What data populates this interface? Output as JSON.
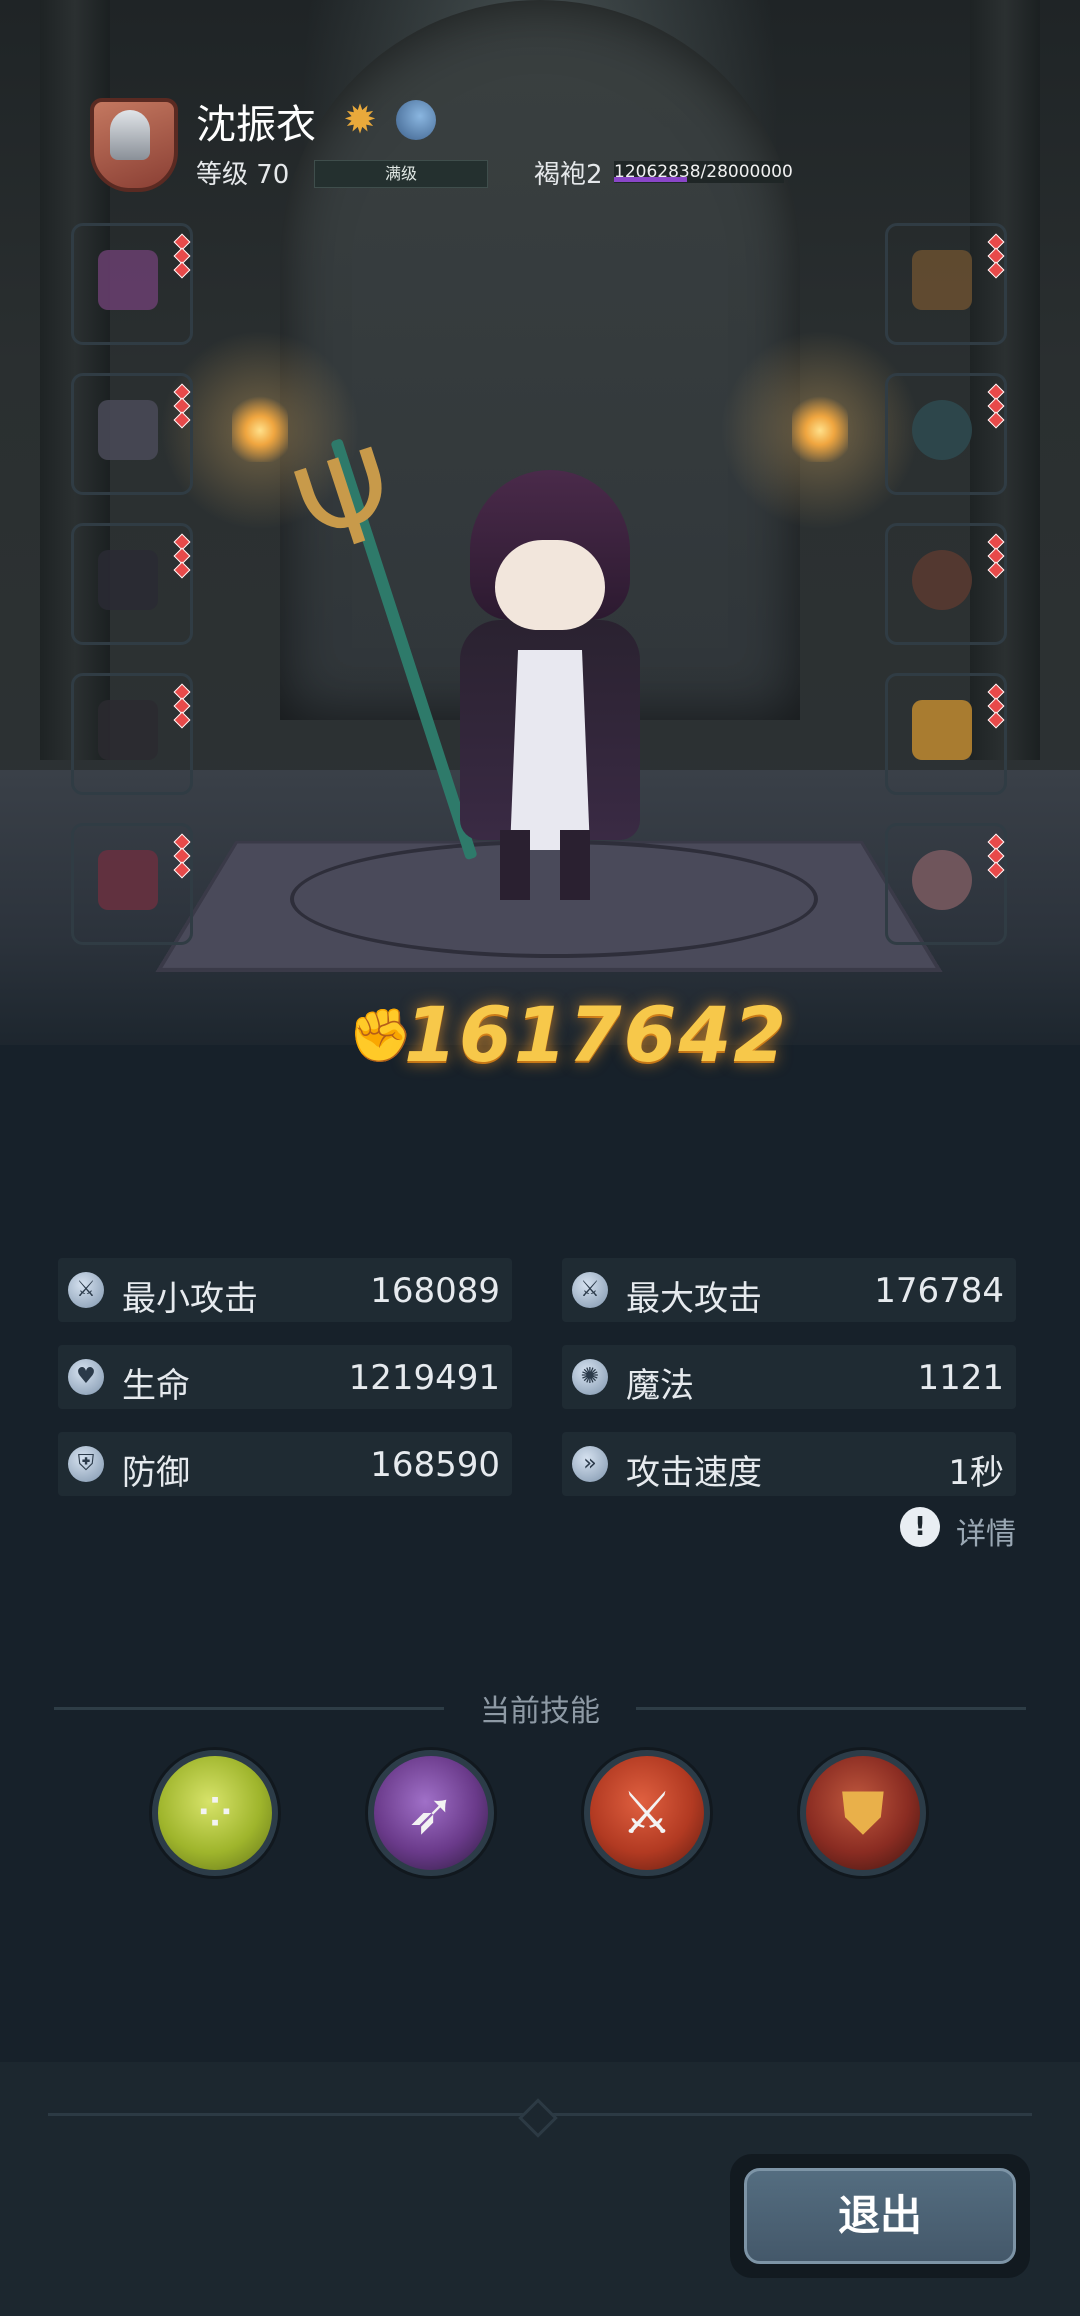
{
  "header": {
    "name": "沈振衣",
    "level_text": "等级 70",
    "level_bar_label": "满级",
    "robe_label": "褐袍2",
    "exp_text": "12062838/28000000",
    "exp_progress": 0.43
  },
  "equipment": {
    "left": [
      {
        "icon": "hood-icon",
        "frame": "green"
      },
      {
        "icon": "armor-icon",
        "frame": "orange"
      },
      {
        "icon": "boots-icon",
        "frame": "orange"
      },
      {
        "icon": "bracer-icon",
        "frame": "orange"
      },
      {
        "icon": "cloak-icon",
        "frame": "green"
      }
    ],
    "right": [
      {
        "icon": "trident-icon",
        "frame": "orange"
      },
      {
        "icon": "ring-icon",
        "frame": "orange"
      },
      {
        "icon": "necklace-icon",
        "frame": "orange"
      },
      {
        "icon": "flame-charm-icon",
        "frame": "orange"
      },
      {
        "icon": "potion-icon",
        "frame": "orange"
      }
    ]
  },
  "power": "1617642",
  "stats": [
    {
      "label": "最小攻击",
      "value": "168089",
      "icon": "sword-icon"
    },
    {
      "label": "最大攻击",
      "value": "176784",
      "icon": "sword-icon"
    },
    {
      "label": "生命",
      "value": "1219491",
      "icon": "heart-icon"
    },
    {
      "label": "魔法",
      "value": "1121",
      "icon": "magic-swirl-icon"
    },
    {
      "label": "防御",
      "value": "168590",
      "icon": "shield-icon"
    },
    {
      "label": "攻击速度",
      "value": "1秒",
      "icon": "speed-icon"
    }
  ],
  "detail_label": "详情",
  "skills_title": "当前技能",
  "skills": [
    {
      "icon": "poison-bubbles-icon",
      "color": "#9fb52c"
    },
    {
      "icon": "purple-strike-icon",
      "color": "#6a3a8a"
    },
    {
      "icon": "crossed-axes-icon",
      "color": "#b23a22"
    },
    {
      "icon": "golden-shield-icon",
      "color": "#8a2c22"
    }
  ],
  "exit_label": "退出",
  "colors": {
    "background": "#17212a",
    "power_gold": "#f7c84a",
    "green_frame": "#4fa04a",
    "orange_frame": "#c8773a",
    "exp_purple": "#8a46c8"
  }
}
